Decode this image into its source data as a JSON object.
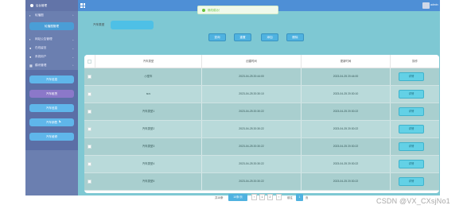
{
  "brand": {
    "title": "后台管理"
  },
  "topbar": {
    "user_name": "admin"
  },
  "toast": {
    "message": "修改成功！"
  },
  "sidebar": {
    "menus": [
      {
        "label": "轮播图",
        "icon": "image-icon"
      },
      {
        "label": "网站公告管理",
        "icon": "notice-icon"
      },
      {
        "label": "在线留言",
        "icon": "message-icon"
      },
      {
        "label": "系统用户",
        "icon": "user-icon"
      },
      {
        "label": "模块管理",
        "icon": "module-icon"
      }
    ],
    "carousel_btn": "轮播图管理",
    "sub_items": [
      "汽车信息",
      "汽车租赁",
      "汽车信息",
      "汽车销售",
      "汽车维修"
    ]
  },
  "search": {
    "label": "汽车类型",
    "placeholder": ""
  },
  "toolbar": {
    "query": "查询",
    "reset": "重置",
    "add": "添加",
    "delete": "删除"
  },
  "table": {
    "columns": [
      "",
      "汽车类型",
      "创建时间",
      "更新时间",
      "操作"
    ],
    "rows": [
      {
        "type": "小型车",
        "created": "2023-04-25 20:44:00",
        "updated": "2023-04-25 20:44:00",
        "action": "详情"
      },
      {
        "type": "suv",
        "created": "2023-04-25 20:30:10",
        "updated": "2023-04-25 20:30:10",
        "action": "详情"
      },
      {
        "type": "汽车类型1",
        "created": "2023-04-25 20:30:22",
        "updated": "2023-04-25 20:30:22",
        "action": "详情"
      },
      {
        "type": "汽车类型2",
        "created": "2023-04-25 20:30:22",
        "updated": "2023-04-25 20:30:22",
        "action": "详情"
      },
      {
        "type": "汽车类型3",
        "created": "2023-04-25 20:30:22",
        "updated": "2023-04-25 20:30:22",
        "action": "详情"
      },
      {
        "type": "汽车类型4",
        "created": "2023-04-25 20:30:22",
        "updated": "2023-04-25 20:30:22",
        "action": "详情"
      },
      {
        "type": "汽车类型5",
        "created": "2023-04-25 20:30:22",
        "updated": "2023-04-25 20:30:22",
        "action": "详情"
      }
    ]
  },
  "pagination": {
    "total_text": "共15条",
    "page_size": "10条/页",
    "pages": [
      "1",
      "2"
    ],
    "goto_label": "前往",
    "goto_value": "1",
    "page_unit": "页"
  },
  "watermark": "CSDN @VX_CXsjNo1",
  "colors": {
    "sidebar": "#6b7fb0",
    "topbar": "#4e8fd6",
    "main": "#7ec8d3",
    "accent": "#4fb2e0"
  }
}
